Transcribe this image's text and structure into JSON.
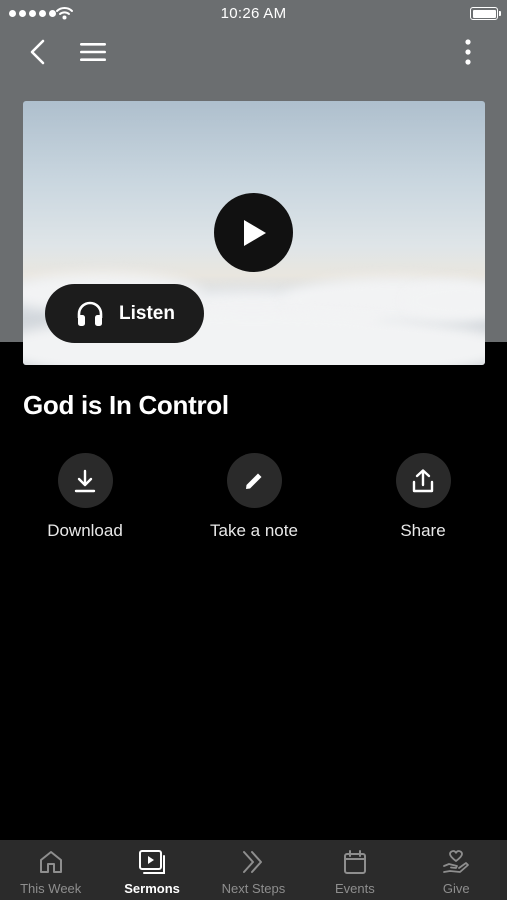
{
  "status_bar": {
    "time": "10:26 AM"
  },
  "nav": {
    "back_icon": "chevron-left-icon",
    "menu_icon": "hamburger-icon",
    "more_icon": "kebab-icon"
  },
  "hero": {
    "play_icon": "play-icon",
    "listen_label": "Listen",
    "listen_icon": "headphones-icon"
  },
  "sermon": {
    "title": "God is In Control"
  },
  "actions": [
    {
      "label": "Download",
      "icon": "download-icon"
    },
    {
      "label": "Take a note",
      "icon": "pencil-icon"
    },
    {
      "label": "Share",
      "icon": "share-icon"
    }
  ],
  "tabs": [
    {
      "label": "This Week",
      "icon": "home-icon",
      "active": false
    },
    {
      "label": "Sermons",
      "icon": "video-library-icon",
      "active": true
    },
    {
      "label": "Next Steps",
      "icon": "double-chevron-icon",
      "active": false
    },
    {
      "label": "Events",
      "icon": "calendar-icon",
      "active": false
    },
    {
      "label": "Give",
      "icon": "hand-heart-icon",
      "active": false
    }
  ],
  "colors": {
    "header_bg": "#6b6e70",
    "page_bg": "#000000",
    "tab_bar_bg": "#2b2b2b",
    "button_bg": "#2a2a2a"
  }
}
